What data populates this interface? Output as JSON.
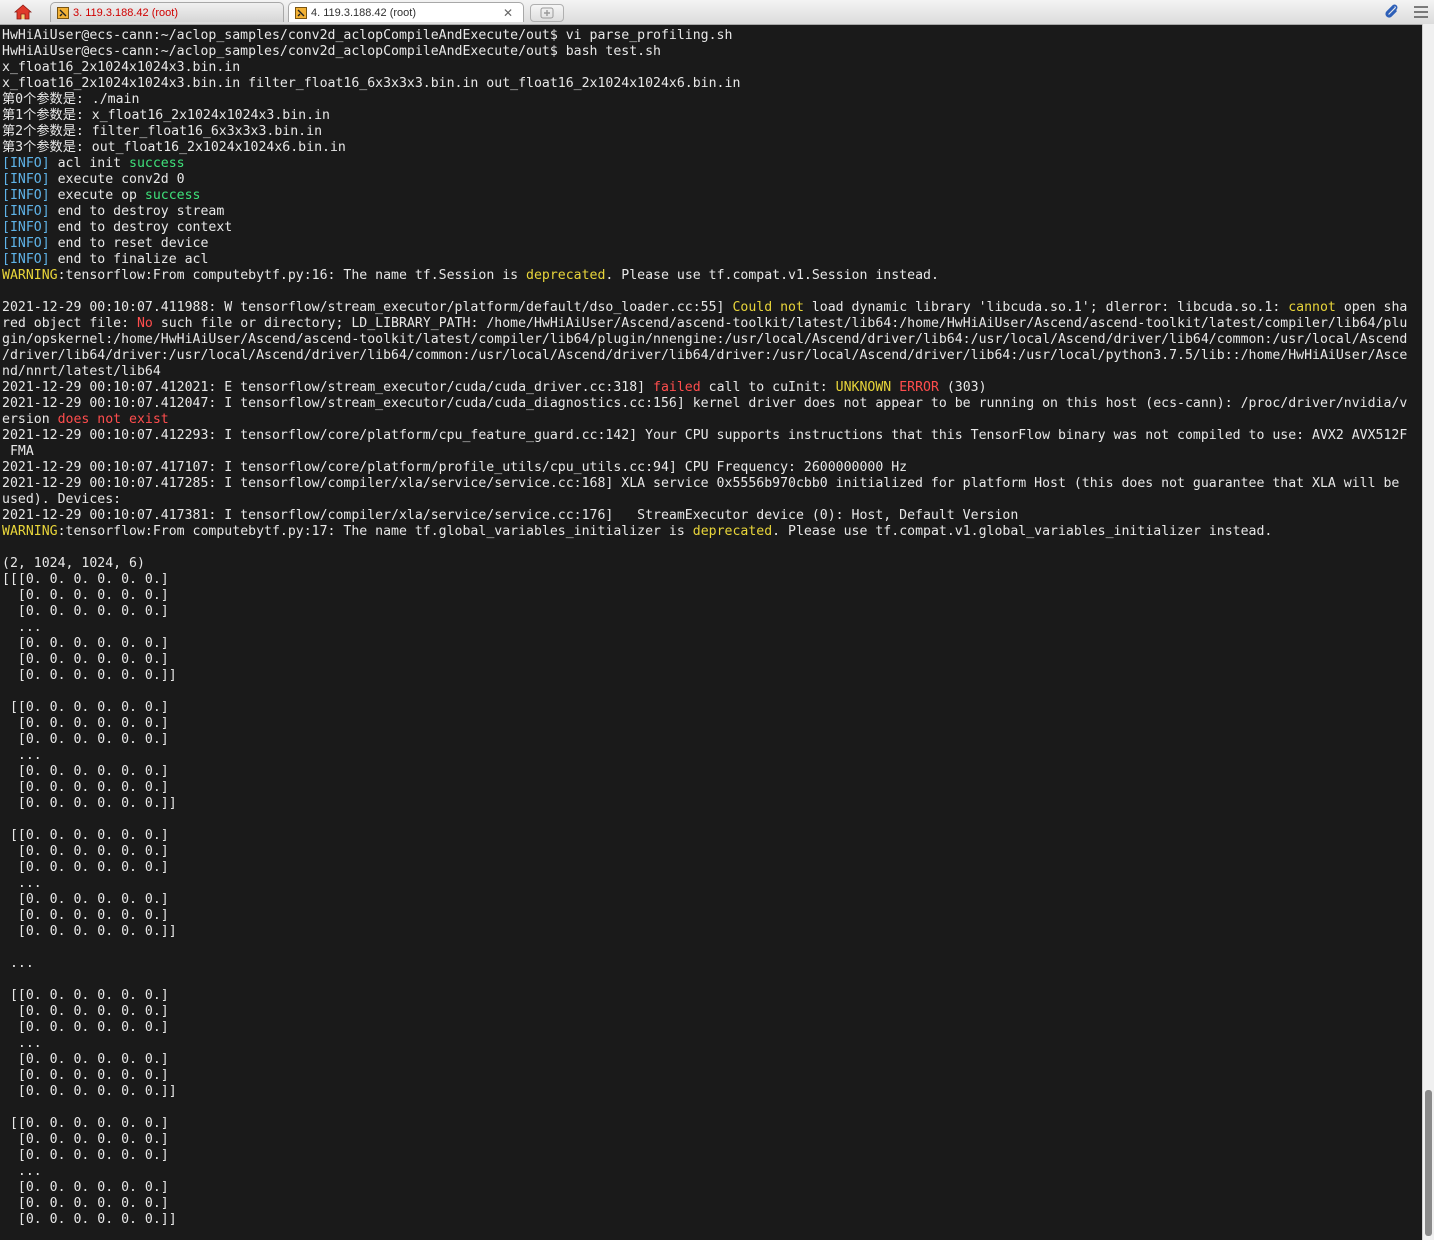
{
  "tabs": [
    {
      "label": "3. 119.3.188.42 (root)",
      "active": false
    },
    {
      "label": "4. 119.3.188.42 (root)",
      "active": true
    }
  ],
  "icons": {
    "home": "home-icon",
    "terminal_tab": "terminal-icon",
    "close": "close-icon",
    "new_tab": "new-tab-icon",
    "attachment": "paperclip-icon",
    "menu": "hamburger-menu-icon"
  },
  "colors": {
    "terminal_bg": "#1a1a1a",
    "text": "#e8e8e8",
    "info": "#5fb3e8",
    "success": "#3fe07a",
    "warning": "#e8d53a",
    "error": "#ff4d4d"
  },
  "terminal_lines": [
    [
      {
        "t": "HwHiAiUser@ecs-cann:~/aclop_samples/conv2d_aclopCompileAndExecute/out$ vi parse_profiling.sh"
      }
    ],
    [
      {
        "t": "HwHiAiUser@ecs-cann:~/aclop_samples/conv2d_aclopCompileAndExecute/out$ bash test.sh"
      }
    ],
    [
      {
        "t": "x_float16_2x1024x1024x3.bin.in"
      }
    ],
    [
      {
        "t": "x_float16_2x1024x1024x3.bin.in filter_float16_6x3x3x3.bin.in out_float16_2x1024x1024x6.bin.in"
      }
    ],
    [
      {
        "t": "第0个参数是: ./main"
      }
    ],
    [
      {
        "t": "第1个参数是: x_float16_2x1024x1024x3.bin.in"
      }
    ],
    [
      {
        "t": "第2个参数是: filter_float16_6x3x3x3.bin.in"
      }
    ],
    [
      {
        "t": "第3个参数是: out_float16_2x1024x1024x6.bin.in"
      }
    ],
    [
      {
        "t": "[INFO]",
        "c": "cyan"
      },
      {
        "t": " acl init "
      },
      {
        "t": "success",
        "c": "green"
      }
    ],
    [
      {
        "t": "[INFO]",
        "c": "cyan"
      },
      {
        "t": " execute conv2d 0"
      }
    ],
    [
      {
        "t": "[INFO]",
        "c": "cyan"
      },
      {
        "t": " execute op "
      },
      {
        "t": "success",
        "c": "green"
      }
    ],
    [
      {
        "t": "[INFO]",
        "c": "cyan"
      },
      {
        "t": " end to destroy stream"
      }
    ],
    [
      {
        "t": "[INFO]",
        "c": "cyan"
      },
      {
        "t": " end to destroy context"
      }
    ],
    [
      {
        "t": "[INFO]",
        "c": "cyan"
      },
      {
        "t": " end to reset device"
      }
    ],
    [
      {
        "t": "[INFO]",
        "c": "cyan"
      },
      {
        "t": " end to finalize acl"
      }
    ],
    [
      {
        "t": "WARNING",
        "c": "yellow"
      },
      {
        "t": ":tensorflow:From computebytf.py:16: The name tf.Session is "
      },
      {
        "t": "deprecated",
        "c": "yellow"
      },
      {
        "t": ". Please use tf.compat.v1.Session instead."
      }
    ],
    [
      {
        "t": ""
      }
    ],
    [
      {
        "t": "2021-12-29 00:10:07.411988: W tensorflow/stream_executor/platform/default/dso_loader.cc:55] "
      },
      {
        "t": "Could not",
        "c": "yellow"
      },
      {
        "t": " load dynamic library 'libcuda.so.1'; dlerror: libcuda.so.1: "
      },
      {
        "t": "cannot",
        "c": "yellow"
      },
      {
        "t": " open sha"
      }
    ],
    [
      {
        "t": "red object file: "
      },
      {
        "t": "No",
        "c": "red"
      },
      {
        "t": " such file or directory; LD_LIBRARY_PATH: /home/HwHiAiUser/Ascend/ascend-toolkit/latest/lib64:/home/HwHiAiUser/Ascend/ascend-toolkit/latest/compiler/lib64/plu"
      }
    ],
    [
      {
        "t": "gin/opskernel:/home/HwHiAiUser/Ascend/ascend-toolkit/latest/compiler/lib64/plugin/nnengine:/usr/local/Ascend/driver/lib64:/usr/local/Ascend/driver/lib64/common:/usr/local/Ascend"
      }
    ],
    [
      {
        "t": "/driver/lib64/driver:/usr/local/Ascend/driver/lib64/common:/usr/local/Ascend/driver/lib64/driver:/usr/local/Ascend/driver/lib64:/usr/local/python3.7.5/lib::/home/HwHiAiUser/Asce"
      }
    ],
    [
      {
        "t": "nd/nnrt/latest/lib64"
      }
    ],
    [
      {
        "t": "2021-12-29 00:10:07.412021: E tensorflow/stream_executor/cuda/cuda_driver.cc:318] "
      },
      {
        "t": "failed",
        "c": "red"
      },
      {
        "t": " call to cuInit: "
      },
      {
        "t": "UNKNOWN",
        "c": "yellow"
      },
      {
        "t": " "
      },
      {
        "t": "ERROR",
        "c": "red"
      },
      {
        "t": " (303)"
      }
    ],
    [
      {
        "t": "2021-12-29 00:10:07.412047: I tensorflow/stream_executor/cuda/cuda_diagnostics.cc:156] kernel driver does not appear to be running on this host (ecs-cann): /proc/driver/nvidia/v"
      }
    ],
    [
      {
        "t": "ersion "
      },
      {
        "t": "does not exist",
        "c": "red"
      }
    ],
    [
      {
        "t": "2021-12-29 00:10:07.412293: I tensorflow/core/platform/cpu_feature_guard.cc:142] Your CPU supports instructions that this TensorFlow binary was not compiled to use: AVX2 AVX512F"
      }
    ],
    [
      {
        "t": " FMA"
      }
    ],
    [
      {
        "t": "2021-12-29 00:10:07.417107: I tensorflow/core/platform/profile_utils/cpu_utils.cc:94] CPU Frequency: 2600000000 Hz"
      }
    ],
    [
      {
        "t": "2021-12-29 00:10:07.417285: I tensorflow/compiler/xla/service/service.cc:168] XLA service 0x5556b970cbb0 initialized for platform Host (this does not guarantee that XLA will be"
      }
    ],
    [
      {
        "t": "used). Devices:"
      }
    ],
    [
      {
        "t": "2021-12-29 00:10:07.417381: I tensorflow/compiler/xla/service/service.cc:176]   StreamExecutor device (0): Host, Default Version"
      }
    ],
    [
      {
        "t": "WARNING",
        "c": "yellow"
      },
      {
        "t": ":tensorflow:From computebytf.py:17: The name tf.global_variables_initializer is "
      },
      {
        "t": "deprecated",
        "c": "yellow"
      },
      {
        "t": ". Please use tf.compat.v1.global_variables_initializer instead."
      }
    ],
    [
      {
        "t": ""
      }
    ],
    [
      {
        "t": "(2, 1024, 1024, 6)"
      }
    ],
    [
      {
        "t": "[[[0. 0. 0. 0. 0. 0.]"
      }
    ],
    [
      {
        "t": "  [0. 0. 0. 0. 0. 0.]"
      }
    ],
    [
      {
        "t": "  [0. 0. 0. 0. 0. 0.]"
      }
    ],
    [
      {
        "t": "  ..."
      }
    ],
    [
      {
        "t": "  [0. 0. 0. 0. 0. 0.]"
      }
    ],
    [
      {
        "t": "  [0. 0. 0. 0. 0. 0.]"
      }
    ],
    [
      {
        "t": "  [0. 0. 0. 0. 0. 0.]]"
      }
    ],
    [
      {
        "t": ""
      }
    ],
    [
      {
        "t": " [[0. 0. 0. 0. 0. 0.]"
      }
    ],
    [
      {
        "t": "  [0. 0. 0. 0. 0. 0.]"
      }
    ],
    [
      {
        "t": "  [0. 0. 0. 0. 0. 0.]"
      }
    ],
    [
      {
        "t": "  ..."
      }
    ],
    [
      {
        "t": "  [0. 0. 0. 0. 0. 0.]"
      }
    ],
    [
      {
        "t": "  [0. 0. 0. 0. 0. 0.]"
      }
    ],
    [
      {
        "t": "  [0. 0. 0. 0. 0. 0.]]"
      }
    ],
    [
      {
        "t": ""
      }
    ],
    [
      {
        "t": " [[0. 0. 0. 0. 0. 0.]"
      }
    ],
    [
      {
        "t": "  [0. 0. 0. 0. 0. 0.]"
      }
    ],
    [
      {
        "t": "  [0. 0. 0. 0. 0. 0.]"
      }
    ],
    [
      {
        "t": "  ..."
      }
    ],
    [
      {
        "t": "  [0. 0. 0. 0. 0. 0.]"
      }
    ],
    [
      {
        "t": "  [0. 0. 0. 0. 0. 0.]"
      }
    ],
    [
      {
        "t": "  [0. 0. 0. 0. 0. 0.]]"
      }
    ],
    [
      {
        "t": ""
      }
    ],
    [
      {
        "t": " ..."
      }
    ],
    [
      {
        "t": ""
      }
    ],
    [
      {
        "t": " [[0. 0. 0. 0. 0. 0.]"
      }
    ],
    [
      {
        "t": "  [0. 0. 0. 0. 0. 0.]"
      }
    ],
    [
      {
        "t": "  [0. 0. 0. 0. 0. 0.]"
      }
    ],
    [
      {
        "t": "  ..."
      }
    ],
    [
      {
        "t": "  [0. 0. 0. 0. 0. 0.]"
      }
    ],
    [
      {
        "t": "  [0. 0. 0. 0. 0. 0.]"
      }
    ],
    [
      {
        "t": "  [0. 0. 0. 0. 0. 0.]]"
      }
    ],
    [
      {
        "t": ""
      }
    ],
    [
      {
        "t": " [[0. 0. 0. 0. 0. 0.]"
      }
    ],
    [
      {
        "t": "  [0. 0. 0. 0. 0. 0.]"
      }
    ],
    [
      {
        "t": "  [0. 0. 0. 0. 0. 0.]"
      }
    ],
    [
      {
        "t": "  ..."
      }
    ],
    [
      {
        "t": "  [0. 0. 0. 0. 0. 0.]"
      }
    ],
    [
      {
        "t": "  [0. 0. 0. 0. 0. 0.]"
      }
    ],
    [
      {
        "t": "  [0. 0. 0. 0. 0. 0.]]"
      }
    ]
  ]
}
